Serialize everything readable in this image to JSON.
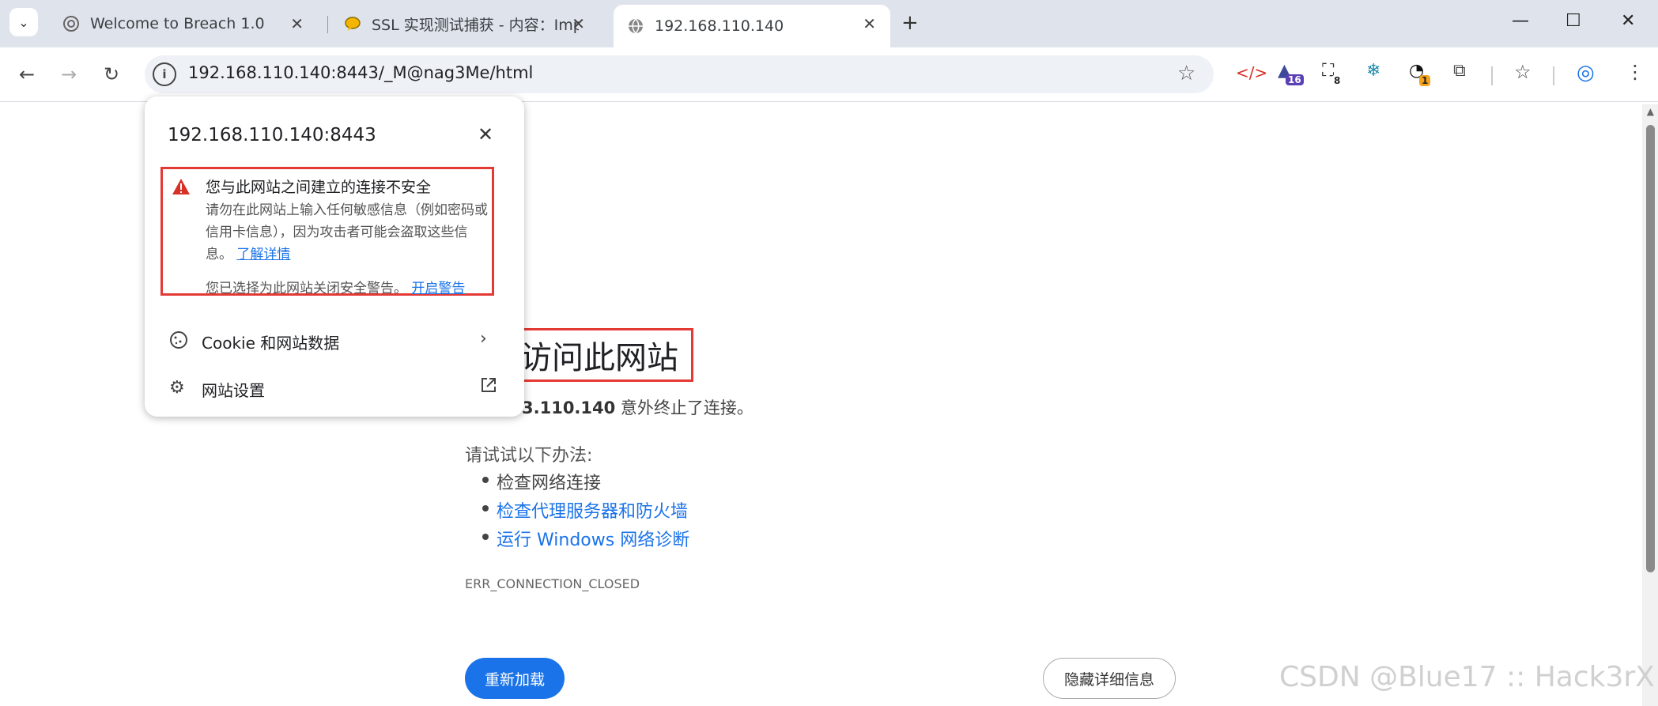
{
  "browser": {
    "tab_list_icon": "chevron-down-icon",
    "tabs": [
      {
        "title": "Welcome to Breach 1.0",
        "icon": "globe-icon"
      },
      {
        "title": "SSL 实现测试捕获 - 内容：Imp",
        "icon": "chat-icon"
      },
      {
        "title": "192.168.110.140",
        "icon": "globe-icon"
      }
    ],
    "new_tab": "+",
    "window": {
      "minimize": "—",
      "maximize": "☐",
      "close": "✕"
    }
  },
  "toolbar": {
    "back": "←",
    "forward": "→",
    "reload": "↻",
    "info": "i",
    "url": "192.168.110.140:8443/_M@nag3Me/html",
    "star": "☆",
    "extensions": [
      {
        "name": "code-icon",
        "glyph": "</>",
        "badge": ""
      },
      {
        "name": "cap-icon",
        "glyph": "🎓",
        "badge": "16"
      },
      {
        "name": "scan-icon",
        "glyph": "⛶",
        "badge": "8"
      },
      {
        "name": "snowflake-icon",
        "glyph": "❄",
        "badge": ""
      },
      {
        "name": "loop-icon",
        "glyph": "◔",
        "badge": "1"
      },
      {
        "name": "puzzle-icon",
        "glyph": "⧉",
        "badge": ""
      }
    ],
    "bookmarks": "☆",
    "profile": "◎",
    "menu": "⋮"
  },
  "popup": {
    "host": "192.168.110.140:8443",
    "close": "✕",
    "warning_title": "您与此网站之间建立的连接不安全",
    "warning_body": "请勿在此网站上输入任何敏感信息（例如密码或信用卡信息），因为攻击者可能会盗取这些信息。",
    "learn_more": "了解详情",
    "disabled_text": "您已选择为此网站关闭安全警告。",
    "enable_warnings": "开启警告",
    "cookie_label": "Cookie 和网站数据",
    "settings_label": "网站设置"
  },
  "error_page": {
    "title": "访问此网站",
    "desc_host": "3.110.140",
    "desc_rest": " 意外终止了连接。",
    "try_label": "请试试以下办法:",
    "suggestions": [
      {
        "text": "检查网络连接",
        "link": false
      },
      {
        "text": "检查代理服务器和防火墙",
        "link": true
      },
      {
        "text": "运行 Windows 网络诊断",
        "link": true
      }
    ],
    "code": "ERR_CONNECTION_CLOSED",
    "reload_button": "重新加载",
    "details_button": "隐藏详细信息"
  },
  "watermark": "CSDN @Blue17 :: Hack3rX",
  "colors": {
    "accent": "#1a73e8",
    "warning": "#d93025",
    "highlight_box": "#e53935"
  }
}
